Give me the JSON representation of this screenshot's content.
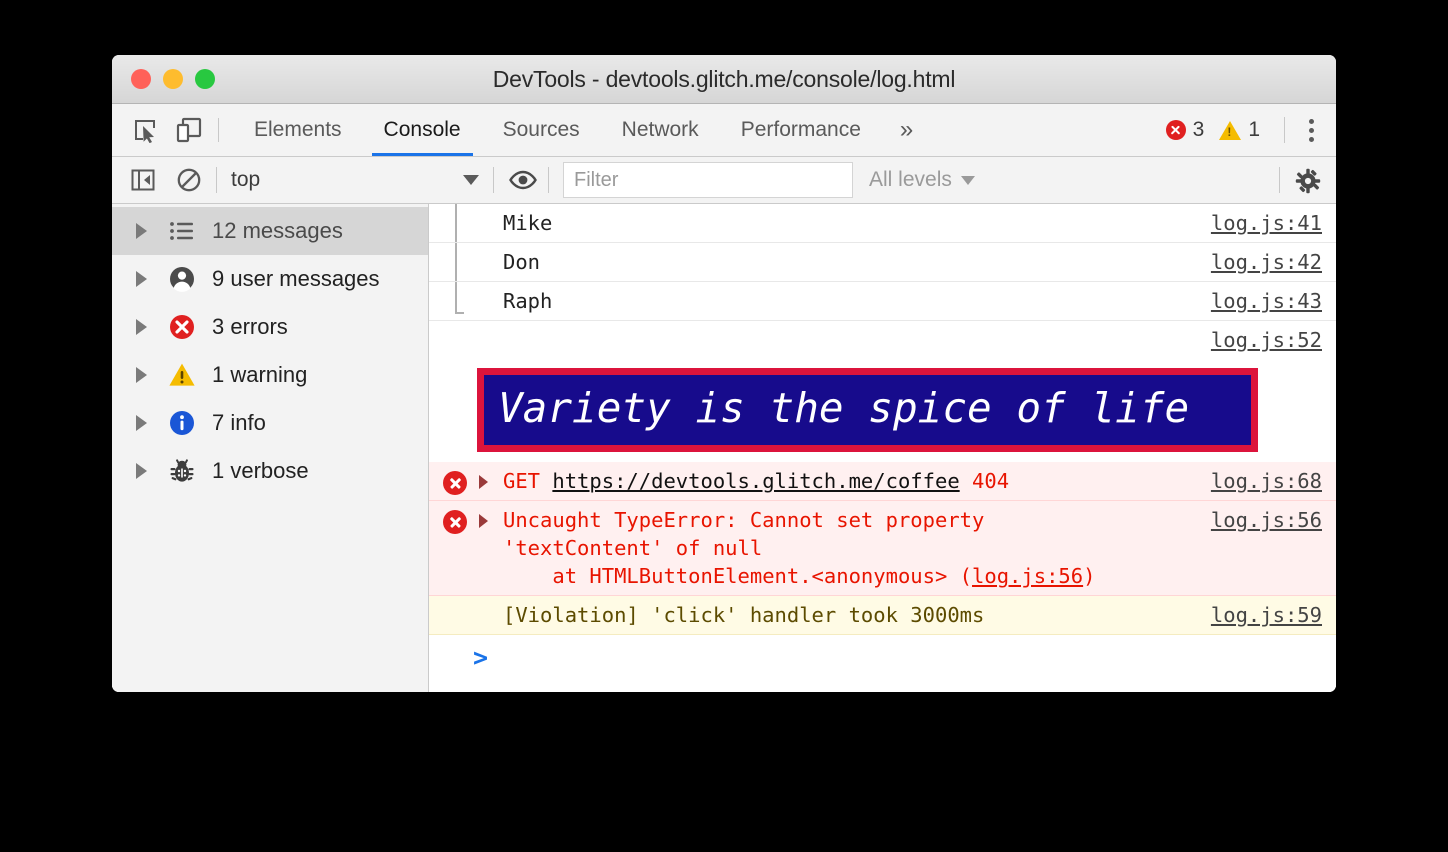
{
  "window": {
    "title": "DevTools - devtools.glitch.me/console/log.html",
    "traffic_lights": [
      "close",
      "minimize",
      "maximize"
    ]
  },
  "tabbar": {
    "icons": [
      "inspect-element-icon",
      "device-toolbar-icon"
    ],
    "tabs": [
      {
        "label": "Elements",
        "active": false
      },
      {
        "label": "Console",
        "active": true
      },
      {
        "label": "Sources",
        "active": false
      },
      {
        "label": "Network",
        "active": false
      },
      {
        "label": "Performance",
        "active": false
      }
    ],
    "more_label": "»",
    "error_count": "3",
    "warning_count": "1",
    "menu_icon": "kebab-menu-icon"
  },
  "console_toolbar": {
    "sidebar_toggle_icon": "sidebar-toggle-icon",
    "clear_icon": "clear-console-icon",
    "context": "top",
    "eye_icon": "live-expression-icon",
    "filter_placeholder": "Filter",
    "filter_value": "",
    "levels": "All levels",
    "settings_icon": "gear-icon"
  },
  "sidebar": {
    "items": [
      {
        "label": "12 messages",
        "icon": "list-icon",
        "selected": true
      },
      {
        "label": "9 user messages",
        "icon": "user-icon",
        "selected": false
      },
      {
        "label": "3 errors",
        "icon": "error-icon",
        "selected": false
      },
      {
        "label": "1 warning",
        "icon": "warning-icon",
        "selected": false
      },
      {
        "label": "7 info",
        "icon": "info-icon",
        "selected": false
      },
      {
        "label": "1 verbose",
        "icon": "bug-icon",
        "selected": false
      }
    ]
  },
  "log": {
    "rows": [
      {
        "type": "grouped",
        "text": "Mike",
        "source": "log.js:41"
      },
      {
        "type": "grouped",
        "text": "Don",
        "source": "log.js:42"
      },
      {
        "type": "grouped_last",
        "text": "Raph",
        "source": "log.js:43"
      },
      {
        "type": "source_only",
        "text": "",
        "source": "log.js:52"
      },
      {
        "type": "banner",
        "text": "Variety is the spice of life",
        "source": ""
      },
      {
        "type": "error",
        "prefix": "GET ",
        "link": "https://devtools.glitch.me/coffee",
        "suffix": " 404",
        "source": "log.js:68"
      },
      {
        "type": "error_stack",
        "line1": "Uncaught TypeError: Cannot set property",
        "line2": "'textContent' of null",
        "line3_pre": "    at HTMLButtonElement.<anonymous> (",
        "line3_link": "log.js:56",
        "line3_post": ")",
        "source": "log.js:56"
      },
      {
        "type": "violation",
        "text": "[Violation] 'click' handler took 3000ms",
        "source": "log.js:59"
      }
    ],
    "prompt": ">"
  },
  "colors": {
    "accent_blue": "#1a73e8",
    "error_red": "#e02020",
    "error_text": "#e81400",
    "warning_yellow": "#f5bc00",
    "info_blue": "#1a56d6",
    "banner_bg": "#170b8c",
    "banner_border": "#dc143c",
    "violation_bg": "#fffbe5",
    "error_row_bg": "#fff0f0"
  }
}
